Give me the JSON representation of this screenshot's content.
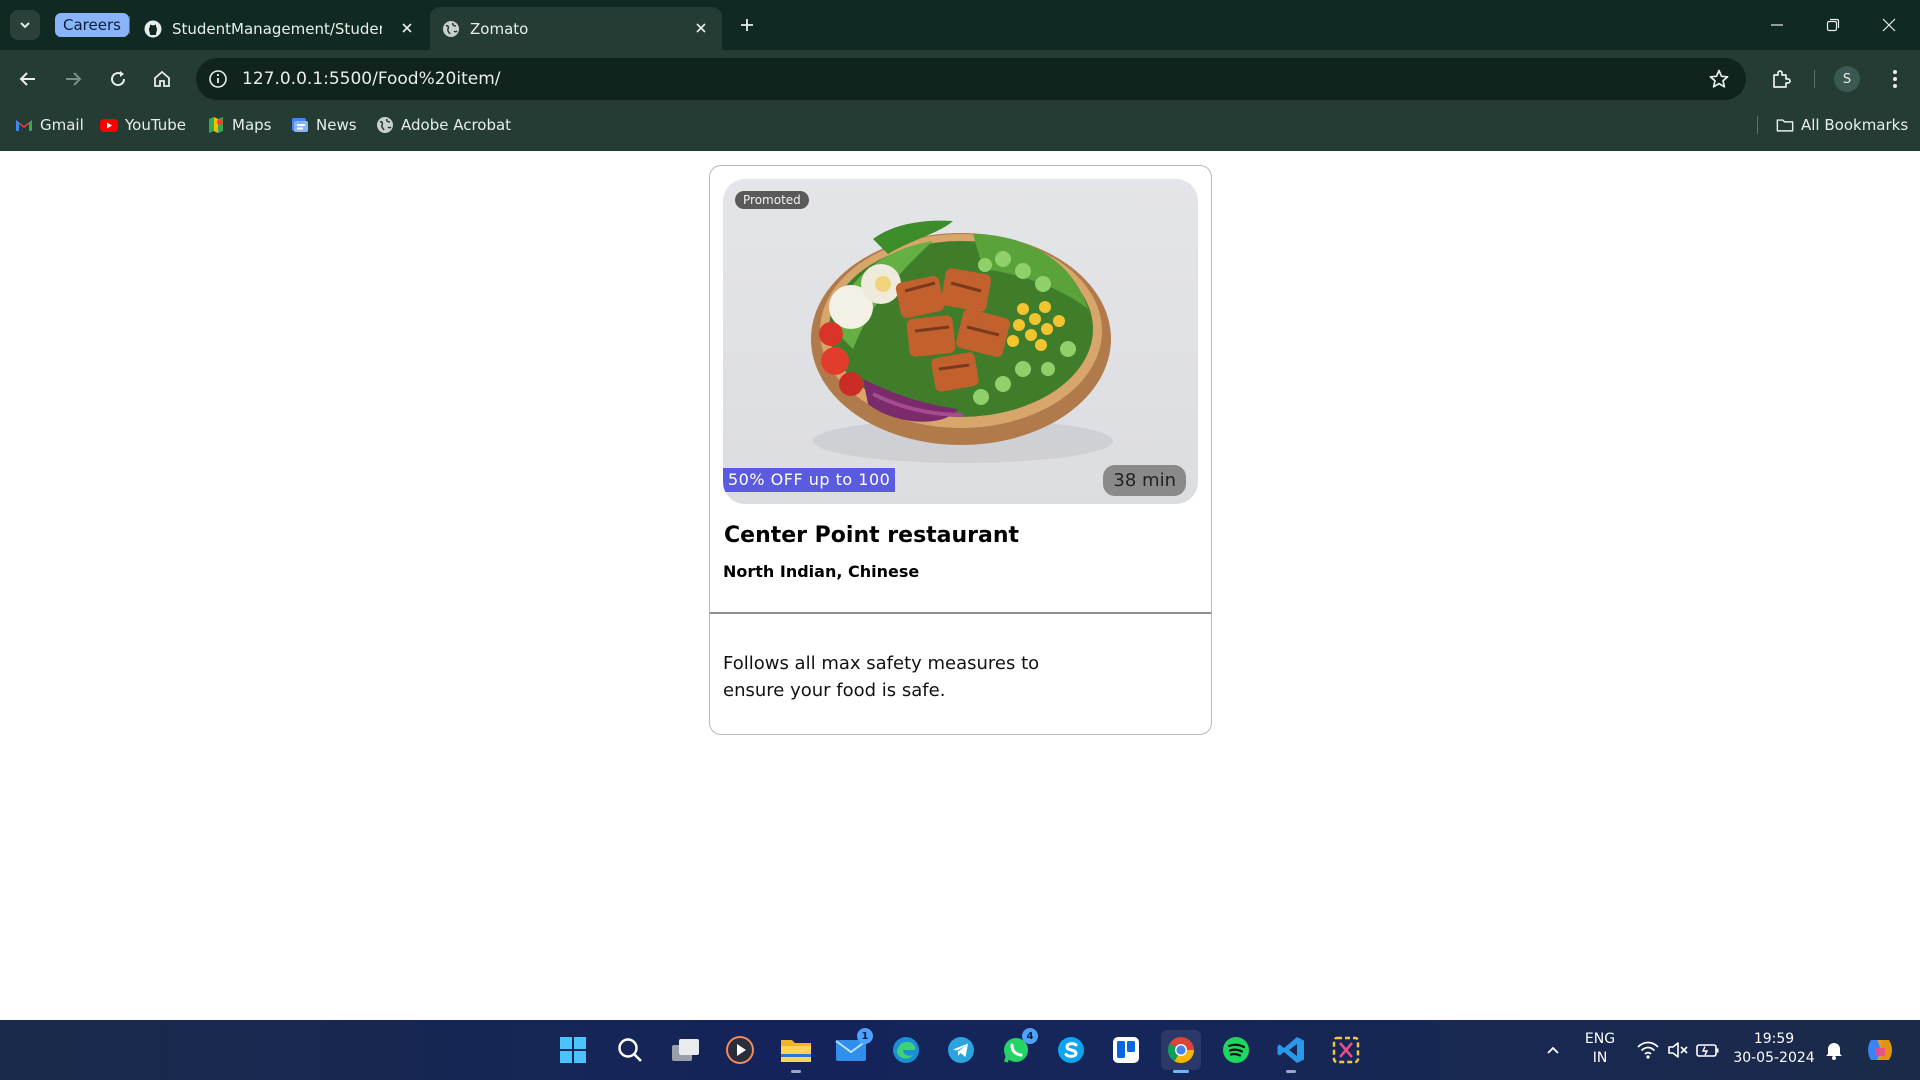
{
  "browser": {
    "tab_group_label": "Careers",
    "tabs": [
      {
        "title": "StudentManagement/StudentM"
      },
      {
        "title": "Zomato"
      }
    ],
    "url": "127.0.0.1:5500/Food%20item/",
    "profile_initial": "S",
    "bookmarks": [
      {
        "label": "Gmail",
        "icon": "gmail-icon"
      },
      {
        "label": "YouTube",
        "icon": "youtube-icon"
      },
      {
        "label": "Maps",
        "icon": "maps-icon"
      },
      {
        "label": "News",
        "icon": "news-icon"
      },
      {
        "label": "Adobe Acrobat",
        "icon": "globe-icon"
      }
    ],
    "all_bookmarks_label": "All Bookmarks"
  },
  "card": {
    "promoted_label": "Promoted",
    "offer": "50% OFF up to 100",
    "eta": "38 min",
    "restaurant_name": "Center Point restaurant",
    "cuisines": "North Indian, Chinese",
    "safety_note": "Follows all max safety measures to ensure your food is safe."
  },
  "taskbar": {
    "apps": [
      {
        "name": "start",
        "icon": "windows-icon"
      },
      {
        "name": "search",
        "icon": "search-icon"
      },
      {
        "name": "task-view",
        "icon": "task-view-icon"
      },
      {
        "name": "media-player",
        "icon": "play-icon"
      },
      {
        "name": "file-explorer",
        "icon": "folder-icon"
      },
      {
        "name": "mail",
        "icon": "mail-icon",
        "badge": "1"
      },
      {
        "name": "edge",
        "icon": "edge-icon"
      },
      {
        "name": "telegram",
        "icon": "telegram-icon"
      },
      {
        "name": "whatsapp",
        "icon": "whatsapp-icon",
        "badge": "4"
      },
      {
        "name": "skype",
        "icon": "skype-icon"
      },
      {
        "name": "trello",
        "icon": "trello-icon"
      },
      {
        "name": "chrome",
        "icon": "chrome-icon"
      },
      {
        "name": "spotify",
        "icon": "spotify-icon"
      },
      {
        "name": "vscode",
        "icon": "vscode-icon"
      },
      {
        "name": "snipping-tool",
        "icon": "snip-icon"
      }
    ],
    "language_line1": "ENG",
    "language_line2": "IN",
    "time": "19:59",
    "date": "30-05-2024"
  },
  "colors": {
    "chrome_frame": "#102a23",
    "chrome_toolbar": "#253c35",
    "offer_badge": "#5b5be0",
    "eta_badge": "#8a8a8a"
  }
}
